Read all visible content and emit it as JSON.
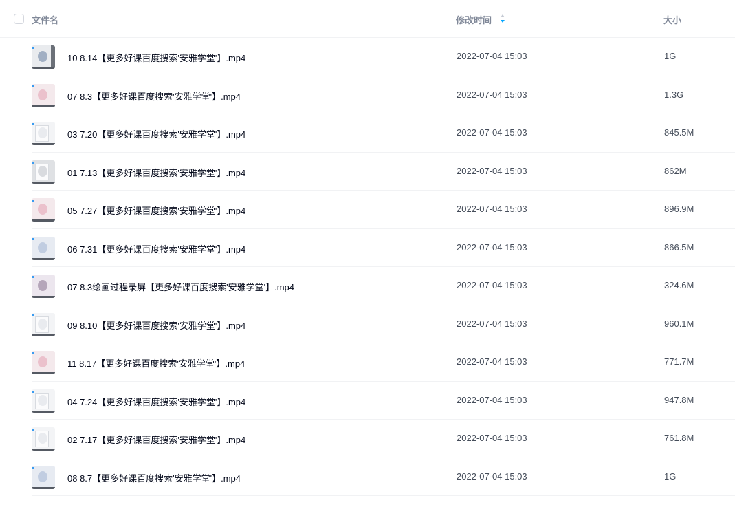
{
  "header": {
    "name_label": "文件名",
    "time_label": "修改时间",
    "size_label": "大小",
    "sort_icon": "sort-icon",
    "sort_active_color": "#06a7ff",
    "sort_inactive_color": "#c4c9d3"
  },
  "files": [
    {
      "name": "10 8.14【更多好课百度搜索'安雅学堂'】.mp4",
      "time": "2022-07-04 15:03",
      "size": "1G",
      "thumb": "video-thumbnail-dark"
    },
    {
      "name": "07 8.3【更多好课百度搜索'安雅学堂'】.mp4",
      "time": "2022-07-04 15:03",
      "size": "1.3G",
      "thumb": "video-thumbnail-pink"
    },
    {
      "name": "03 7.20【更多好课百度搜索'安雅学堂'】.mp4",
      "time": "2022-07-04 15:03",
      "size": "845.5M",
      "thumb": "video-thumbnail-sketch"
    },
    {
      "name": "01 7.13【更多好课百度搜索'安雅学堂'】.mp4",
      "time": "2022-07-04 15:03",
      "size": "862M",
      "thumb": "video-thumbnail-gray"
    },
    {
      "name": "05 7.27【更多好课百度搜索'安雅学堂'】.mp4",
      "time": "2022-07-04 15:03",
      "size": "896.9M",
      "thumb": "video-thumbnail-pink"
    },
    {
      "name": "06 7.31【更多好课百度搜索'安雅学堂'】.mp4",
      "time": "2022-07-04 15:03",
      "size": "866.5M",
      "thumb": "video-thumbnail-blue"
    },
    {
      "name": "07 8.3绘画过程录屏【更多好课百度搜索'安雅学堂'】.mp4",
      "time": "2022-07-04 15:03",
      "size": "324.6M",
      "thumb": "video-thumbnail-purple"
    },
    {
      "name": "09 8.10【更多好课百度搜索'安雅学堂'】.mp4",
      "time": "2022-07-04 15:03",
      "size": "960.1M",
      "thumb": "video-thumbnail-sketch"
    },
    {
      "name": "11 8.17【更多好课百度搜索'安雅学堂'】.mp4",
      "time": "2022-07-04 15:03",
      "size": "771.7M",
      "thumb": "video-thumbnail-pink"
    },
    {
      "name": "04 7.24【更多好课百度搜索'安雅学堂'】.mp4",
      "time": "2022-07-04 15:03",
      "size": "947.8M",
      "thumb": "video-thumbnail-sketch"
    },
    {
      "name": "02 7.17【更多好课百度搜索'安雅学堂'】.mp4",
      "time": "2022-07-04 15:03",
      "size": "761.8M",
      "thumb": "video-thumbnail-sketch"
    },
    {
      "name": "08 8.7【更多好课百度搜索'安雅学堂'】.mp4",
      "time": "2022-07-04 15:03",
      "size": "1G",
      "thumb": "video-thumbnail-blue"
    }
  ]
}
